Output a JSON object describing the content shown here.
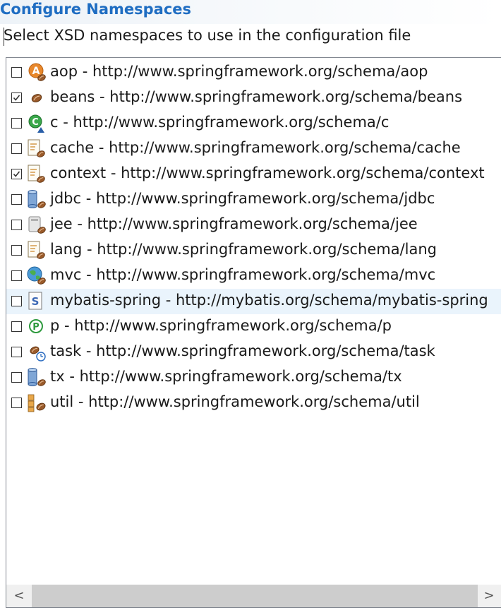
{
  "header": {
    "title": "Configure Namespaces",
    "description": "Select XSD namespaces to use in the configuration file"
  },
  "colors": {
    "title": "#1f6dc2",
    "highlight_row": "#eaf4fc"
  },
  "namespaces": [
    {
      "label": "aop - http://www.springframework.org/schema/aop",
      "checked": false,
      "icon": "aop-icon"
    },
    {
      "label": "beans - http://www.springframework.org/schema/beans",
      "checked": true,
      "icon": "bean-icon"
    },
    {
      "label": "c - http://www.springframework.org/schema/c",
      "checked": false,
      "icon": "c-namespace-icon"
    },
    {
      "label": "cache - http://www.springframework.org/schema/cache",
      "checked": false,
      "icon": "cache-icon"
    },
    {
      "label": "context - http://www.springframework.org/schema/context",
      "checked": true,
      "icon": "context-icon"
    },
    {
      "label": "jdbc - http://www.springframework.org/schema/jdbc",
      "checked": false,
      "icon": "jdbc-icon"
    },
    {
      "label": "jee - http://www.springframework.org/schema/jee",
      "checked": false,
      "icon": "jee-icon"
    },
    {
      "label": "lang - http://www.springframework.org/schema/lang",
      "checked": false,
      "icon": "lang-icon"
    },
    {
      "label": "mvc - http://www.springframework.org/schema/mvc",
      "checked": false,
      "icon": "mvc-globe-icon"
    },
    {
      "label": "mybatis-spring - http://mybatis.org/schema/mybatis-spring",
      "checked": false,
      "icon": "schema-s-icon",
      "highlight": true
    },
    {
      "label": "p - http://www.springframework.org/schema/p",
      "checked": false,
      "icon": "p-namespace-icon"
    },
    {
      "label": "task - http://www.springframework.org/schema/task",
      "checked": false,
      "icon": "task-icon"
    },
    {
      "label": "tx - http://www.springframework.org/schema/tx",
      "checked": false,
      "icon": "tx-icon"
    },
    {
      "label": "util - http://www.springframework.org/schema/util",
      "checked": false,
      "icon": "util-icon"
    }
  ],
  "scrollbar": {
    "left_arrow": "<",
    "right_arrow": ">"
  }
}
